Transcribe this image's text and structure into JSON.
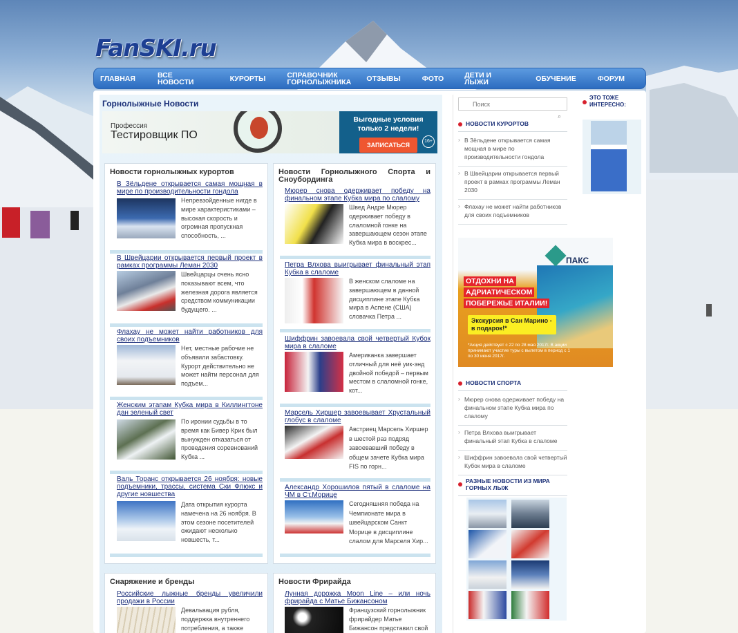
{
  "site": {
    "logo": "FanSKI.ru"
  },
  "nav": [
    "ГЛАВНАЯ",
    "ВСЕ НОВОСТИ",
    "КУРОРТЫ",
    "СПРАВОЧНИК ГОРНОЛЫЖНИКА",
    "ОТЗЫВЫ",
    "ФОТО",
    "ДЕТИ И ЛЫЖИ",
    "ОБУЧЕНИЕ",
    "ФОРУМ"
  ],
  "main": {
    "title": "Горнолыжные Новости"
  },
  "banner1": {
    "profession": "Профессия",
    "job": "Тестировщик ПО",
    "offer": "Выгодные условия только 2 недели!",
    "button": "ЗАПИСАТЬСЯ",
    "age": "16+"
  },
  "col1": {
    "title": "Новости горнолыжных курортов",
    "articles": [
      {
        "title": "В Зёльдене открывается самая мощная в мире по производительности гондола",
        "text": "Непревзойденные нигде в мире характеристиками – высокая скорость и огромная пропускная способность, ..."
      },
      {
        "title": "В Швейцарии открывается первый проект в рамках программы Леман 2030",
        "text": "Швейцарцы очень ясно показывают всем, что железная дорога является средством коммуникации будущего. ..."
      },
      {
        "title": "Флахау не может найти работников для своих подъемников",
        "text": "Нет, местные рабочие не объявили забастовку. Курорт действительно не может найти персонал для подъем..."
      },
      {
        "title": "Женским этапам Кубка мира в Киллингтоне дан зеленый свет",
        "text": "По иронии судьбы в то время как Бивер Крик был вынужден отказаться от проведения соревнований Кубка ..."
      },
      {
        "title": "Валь Торанс открывается 26 ноября: новые подъемники, трассы, система Ски Флюкс и другие новшества",
        "text": "Дата открытия курорта намечена на 26 ноября. В этом сезоне посетителей ожидают несколько новшесть, т..."
      }
    ]
  },
  "col2": {
    "title": "Новости Горнолыжного Спорта и Сноубординга",
    "articles": [
      {
        "title": "Мюрер снова одерживает победу на финальном этапе Кубка мира по слалому",
        "text": "Швед Андре Мюрер одерживает победу в слаломной гонке на завершающем сезон этапе Кубка мира в воскрес..."
      },
      {
        "title": "Петра Влхова выигрывает финальный этап Кубка в слаломе",
        "text": "В женском слаломе на завершающем в данной дисциплине этапе Кубка мира в Аспене (США) словачка Петра ..."
      },
      {
        "title": "Шиффрин завоевала свой четвертый Кубок мира в слаломе",
        "text": "Американка завершает отличный для неё уик-энд двойной победой – первым местом в слаломной гонке, кот..."
      },
      {
        "title": "Марсель Хиршер завоевывает Хрустальный глобус в слаломе",
        "text": "Австриец Марсель Хиршер в шестой раз подряд завоевавший победу в общем зачете Кубка мира FIS по горн..."
      },
      {
        "title": "Александр Хорошилов пятый в слаломе на ЧМ в Ст.Морице",
        "text": "Сегодняшняя победа на Чемпионате мира в швейцарском Санкт Морице в дисциплине слалом для Марселя Хир..."
      }
    ]
  },
  "col3": {
    "title": "Снаряжение и бренды",
    "article": {
      "title": "Российские лыжные бренды увеличили продажи в России",
      "text": "Девальвация рубля, поддержка внутреннего потребления, а также"
    }
  },
  "col4": {
    "title": "Новости Фрирайда",
    "article": {
      "title": "Лунная дорожка Moon Line – или ночь фрирайда с Матье Бижансоном",
      "text": "Французский горнолыжник фрирайдер Матье Бижансон представил свой"
    }
  },
  "sidebar": {
    "search_placeholder": "Поиск",
    "resorts_title": "НОВОСТИ КУРОРТОВ",
    "resorts": [
      "В Зёльдене открывается самая мощная в мире по производительности гондола",
      "В Швейцарии открывается первый проект в рамках программы Леман 2030",
      "Флахау не может найти работников для своих подъемников"
    ],
    "sport_title": "НОВОСТИ СПОРТА",
    "sport": [
      "Мюрер снова одерживает победу на финальном этапе Кубка мира по слалому",
      "Петра Влхова выигрывает финальный этап Кубка в слаломе",
      "Шиффрин завоевала свой четвертый Кубок мира в слаломе"
    ],
    "photos_title": "РАЗНЫЕ НОВОСТИ ИЗ МИРА ГОРНЫХ ЛЫЖ"
  },
  "ad_paks": {
    "brand": "ПАКС",
    "line1": "ОТДОХНИ НА",
    "line2": "АДРИАТИЧЕСКОМ",
    "line3": "ПОБЕРЕЖЬЕ ИТАЛИИ!",
    "promo": "Экскурсия в Сан Марино - в подарок!*",
    "fine": "*Акция действует с 22 по 28 мая 2017г. В акции принимают участие туры с вылетом в период с 1 по 30 июня 2017г."
  },
  "also": {
    "title": "ЭТО ТОЖЕ ИНТЕРЕСНО:"
  }
}
